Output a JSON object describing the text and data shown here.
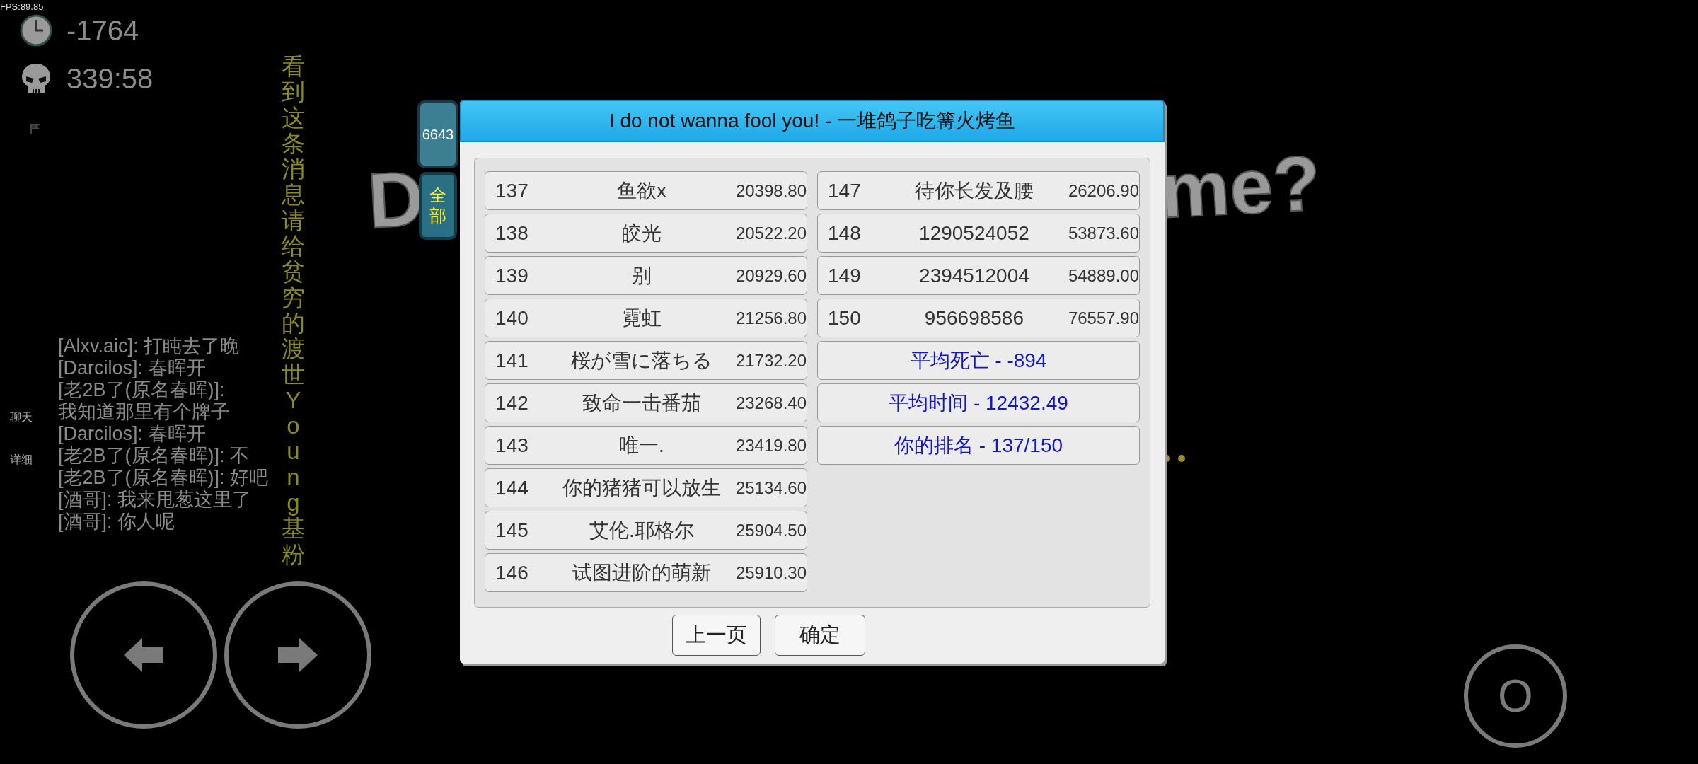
{
  "hud": {
    "fps": "FPS:89.85",
    "time": "-1764",
    "deaths": "339:58"
  },
  "banner": "看到这条消息请给贫穷的渡世Young基粉",
  "chat": {
    "tabs": [
      {
        "label": "聊天"
      },
      {
        "label": "详细"
      }
    ],
    "lines": [
      "[Alxv.aic]: 打盹去了晚",
      "[Darcilos]: 春晖开",
      "[老2B了(原名春晖)]:",
      "我知道那里有个牌子",
      "[Darcilos]: 春晖开",
      "[老2B了(原名春晖)]: 不",
      "[老2B了(原名春晖)]: 好吧",
      "[酒哥]: 我来甩葱这里了",
      "[酒哥]: 你人呢"
    ]
  },
  "background_text": {
    "left": "D",
    "right": "me?"
  },
  "side_tabs": [
    {
      "label": "6643",
      "selected": false
    },
    {
      "label": "全部",
      "selected": true
    }
  ],
  "dialog": {
    "title": "I do not wanna fool you! - 一堆鸽子吃篝火烤鱼",
    "left_column": [
      {
        "kind": "player",
        "rank": "137",
        "name": "鱼欲x",
        "score": "20398.80"
      },
      {
        "kind": "player",
        "rank": "138",
        "name": "皎光",
        "score": "20522.20"
      },
      {
        "kind": "player",
        "rank": "139",
        "name": "别",
        "score": "20929.60"
      },
      {
        "kind": "player",
        "rank": "140",
        "name": "霓虹",
        "score": "21256.80"
      },
      {
        "kind": "player",
        "rank": "141",
        "name": "桜が雪に落ちる",
        "score": "21732.20"
      },
      {
        "kind": "player",
        "rank": "142",
        "name": "致命一击番茄",
        "score": "23268.40"
      },
      {
        "kind": "player",
        "rank": "143",
        "name": "唯一.",
        "score": "23419.80"
      },
      {
        "kind": "player",
        "rank": "144",
        "name": "你的猪猪可以放生",
        "score": "25134.60"
      },
      {
        "kind": "player",
        "rank": "145",
        "name": "艾伦.耶格尔",
        "score": "25904.50"
      },
      {
        "kind": "player",
        "rank": "146",
        "name": "试图进阶的萌新",
        "score": "25910.30"
      }
    ],
    "right_column": [
      {
        "kind": "player",
        "rank": "147",
        "name": "待你长发及腰",
        "score": "26206.90"
      },
      {
        "kind": "player",
        "rank": "148",
        "name": "1290524052",
        "score": "53873.60"
      },
      {
        "kind": "player",
        "rank": "149",
        "name": "2394512004",
        "score": "54889.00"
      },
      {
        "kind": "player",
        "rank": "150",
        "name": "956698586",
        "score": "76557.90"
      },
      {
        "kind": "summary",
        "text": "平均死亡 - -894"
      },
      {
        "kind": "summary",
        "text": "平均时间 - 12432.49"
      },
      {
        "kind": "summary",
        "text": "你的排名 - 137/150"
      }
    ],
    "buttons": [
      "上一页",
      "确定"
    ]
  },
  "controls": {
    "action": "O"
  }
}
